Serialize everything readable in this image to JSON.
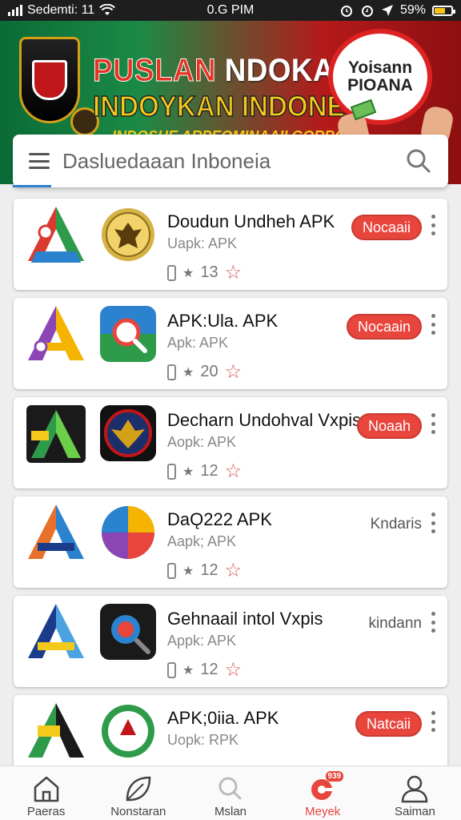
{
  "status_bar": {
    "carrier": "Sedemti: 11",
    "time": "0.G PIM",
    "battery": "59%",
    "battery_level": 0.59
  },
  "banner": {
    "title_line1_a": "PUSLAN",
    "title_line1_b": "NDOKAN",
    "title_line2": "INDOYKAN INDONESIA",
    "subtitle": "INDOSHE ARPEOMINAAII GORBCS",
    "badge_text": "Yoisann PIOANA",
    "colors": {
      "green": "#0b6b36",
      "red": "#b41a1a",
      "yellow": "#f4c91c"
    }
  },
  "search": {
    "placeholder": "Dasluedaaan Inboneia"
  },
  "apps": [
    {
      "name": "Doudun Undheh APK",
      "sub": "Uapk: APK",
      "count": "13",
      "action_type": "button",
      "action_label": "Nocaaii"
    },
    {
      "name": "APK:Ula. APK",
      "sub": "Apk: APK",
      "count": "20",
      "action_type": "button",
      "action_label": "Nocaain"
    },
    {
      "name": "Decharn Undohval Vxpis",
      "sub": "Aopk: APK",
      "count": "12",
      "action_type": "button",
      "action_label": "Noaah"
    },
    {
      "name": "DaǪ222 APK",
      "sub": "Aapk; APK",
      "count": "12",
      "action_type": "text",
      "action_label": "Kndaris"
    },
    {
      "name": "Gehnaail intol Vxpis",
      "sub": "Appk: APK",
      "count": "12",
      "action_type": "text",
      "action_label": "kindann"
    },
    {
      "name": "APK;0iia. APK",
      "sub": "Uopk: RPK",
      "count": "",
      "action_type": "button",
      "action_label": "Natcaii"
    }
  ],
  "bottom_nav": [
    {
      "label": "Paeras",
      "icon": "home-icon"
    },
    {
      "label": "Nonstaran",
      "icon": "leaf-icon"
    },
    {
      "label": "Mslan",
      "icon": "search-icon"
    },
    {
      "label": "Meyek",
      "icon": "hot-icon",
      "badge": "939",
      "active": true
    },
    {
      "label": "Saiman",
      "icon": "profile-icon"
    }
  ],
  "accent_color": "#e8453c"
}
